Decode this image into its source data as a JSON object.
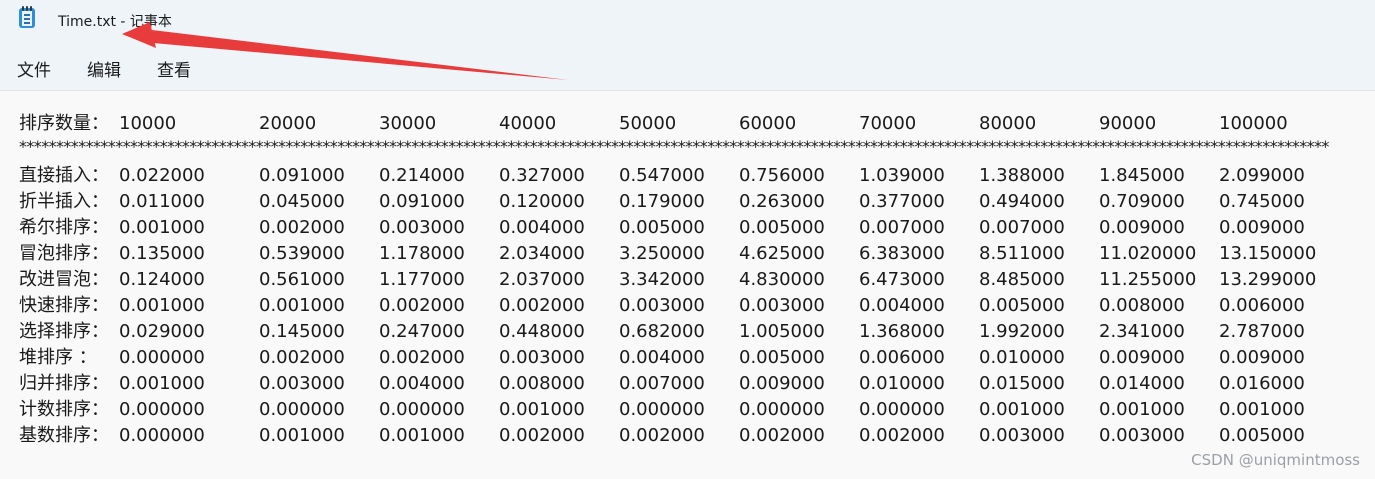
{
  "window": {
    "title": "Time.txt - 记事本",
    "icon": "notepad-icon"
  },
  "menu": {
    "items": [
      "文件",
      "编辑",
      "查看"
    ]
  },
  "annotation": {
    "color": "#e83b3b"
  },
  "document": {
    "header_label": "排序数量：",
    "sizes": [
      "10000",
      "20000",
      "30000",
      "40000",
      "50000",
      "60000",
      "70000",
      "80000",
      "90000",
      "100000"
    ],
    "separator": "**************************************************************************************************************************************************************************************************************************************************",
    "rows": [
      {
        "label": "直接插入：",
        "values": [
          "0.022000",
          "0.091000",
          "0.214000",
          "0.327000",
          "0.547000",
          "0.756000",
          "1.039000",
          "1.388000",
          "1.845000",
          "2.099000"
        ]
      },
      {
        "label": "折半插入：",
        "values": [
          "0.011000",
          "0.045000",
          "0.091000",
          "0.120000",
          "0.179000",
          "0.263000",
          "0.377000",
          "0.494000",
          "0.709000",
          "0.745000"
        ]
      },
      {
        "label": "希尔排序：",
        "values": [
          "0.001000",
          "0.002000",
          "0.003000",
          "0.004000",
          "0.005000",
          "0.005000",
          "0.007000",
          "0.007000",
          "0.009000",
          "0.009000"
        ]
      },
      {
        "label": "冒泡排序：",
        "values": [
          "0.135000",
          "0.539000",
          "1.178000",
          "2.034000",
          "3.250000",
          "4.625000",
          "6.383000",
          "8.511000",
          "11.020000",
          "13.150000"
        ]
      },
      {
        "label": "改进冒泡：",
        "values": [
          "0.124000",
          "0.561000",
          "1.177000",
          "2.037000",
          "3.342000",
          "4.830000",
          "6.473000",
          "8.485000",
          "11.255000",
          "13.299000"
        ]
      },
      {
        "label": "快速排序：",
        "values": [
          "0.001000",
          "0.001000",
          "0.002000",
          "0.002000",
          "0.003000",
          "0.003000",
          "0.004000",
          "0.005000",
          "0.008000",
          "0.006000"
        ]
      },
      {
        "label": "选择排序：",
        "values": [
          "0.029000",
          "0.145000",
          "0.247000",
          "0.448000",
          "0.682000",
          "1.005000",
          "1.368000",
          "1.992000",
          "2.341000",
          "2.787000"
        ]
      },
      {
        "label": "堆排序  ：",
        "values": [
          "0.000000",
          "0.002000",
          "0.002000",
          "0.003000",
          "0.004000",
          "0.005000",
          "0.006000",
          "0.010000",
          "0.009000",
          "0.009000"
        ]
      },
      {
        "label": "归并排序：",
        "values": [
          "0.001000",
          "0.003000",
          "0.004000",
          "0.008000",
          "0.007000",
          "0.009000",
          "0.010000",
          "0.015000",
          "0.014000",
          "0.016000"
        ]
      },
      {
        "label": "计数排序：",
        "values": [
          "0.000000",
          "0.000000",
          "0.000000",
          "0.001000",
          "0.000000",
          "0.000000",
          "0.000000",
          "0.001000",
          "0.001000",
          "0.001000"
        ]
      },
      {
        "label": "基数排序：",
        "values": [
          "0.000000",
          "0.001000",
          "0.001000",
          "0.002000",
          "0.002000",
          "0.002000",
          "0.002000",
          "0.003000",
          "0.003000",
          "0.005000"
        ]
      }
    ]
  },
  "watermark": "CSDN @uniqmintmoss"
}
